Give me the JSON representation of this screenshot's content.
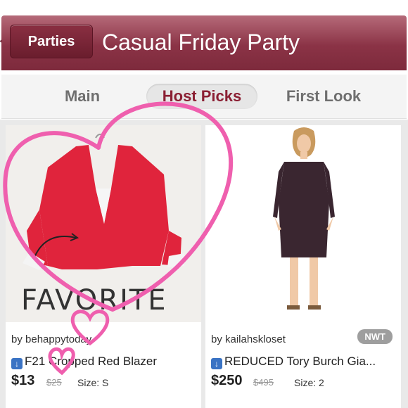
{
  "header": {
    "back_label": "Parties",
    "title": "Casual Friday Party"
  },
  "tabs": [
    {
      "label": "Main"
    },
    {
      "label": "Host Picks"
    },
    {
      "label": "First Look"
    }
  ],
  "active_tab": "Host Picks",
  "listings": [
    {
      "seller": "by behappytoday",
      "title": "F21 Cropped Red Blazer",
      "price": "$13",
      "original_price": "$25",
      "size": "Size: S",
      "photo_caption": "FAVORITE",
      "badge": ""
    },
    {
      "seller": "by kailahskloset",
      "title": "REDUCED Tory Burch Gia...",
      "price": "$250",
      "original_price": "$495",
      "size": "Size: 2",
      "badge": "NWT"
    }
  ],
  "colors": {
    "header": "#8b3346",
    "active_tab_text": "#8b1f33",
    "annotation_pink": "#ef5fae",
    "blazer_red": "#e0243c"
  }
}
